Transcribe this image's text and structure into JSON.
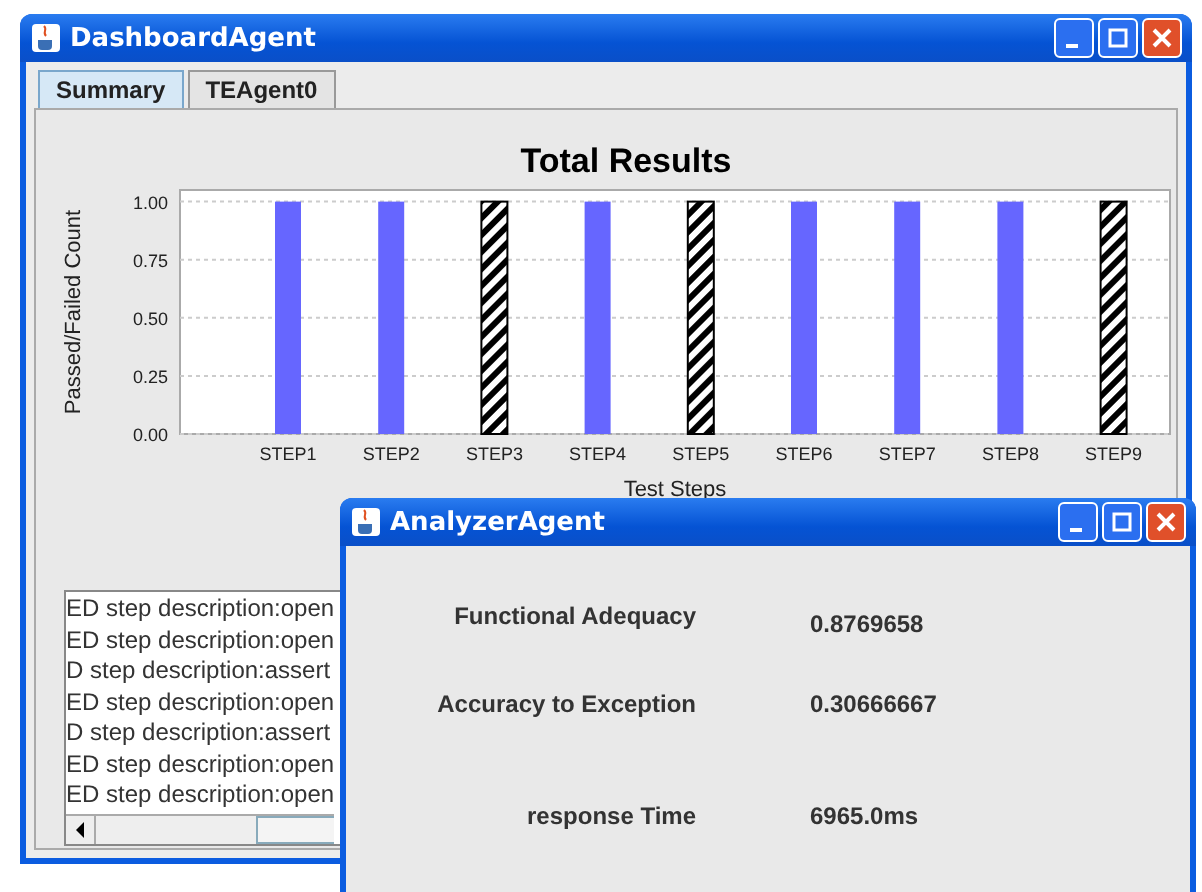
{
  "main_window": {
    "title": "DashboardAgent"
  },
  "tabs": [
    {
      "label": "Summary",
      "selected": true
    },
    {
      "label": "TEAgent0",
      "selected": false
    }
  ],
  "chart": {
    "chart_data": {
      "type": "bar",
      "title": "Total Results",
      "xlabel": "Test Steps",
      "ylabel": "Passed/Failed Count",
      "categories": [
        "STEP1",
        "STEP2",
        "STEP3",
        "STEP4",
        "STEP5",
        "STEP6",
        "STEP7",
        "STEP8",
        "STEP9"
      ],
      "series": [
        {
          "color": "#6666ff",
          "values": [
            1,
            1,
            0,
            1,
            0,
            1,
            1,
            1,
            0
          ]
        },
        {
          "color": "#000000",
          "values": [
            0,
            0,
            1,
            0,
            1,
            0,
            0,
            0,
            1
          ]
        }
      ],
      "grid": true,
      "ylim": [
        0,
        1.05
      ],
      "yticks": [
        {
          "value": 0,
          "label": "0.00"
        },
        {
          "value": 0.25,
          "label": "0.25"
        },
        {
          "value": 0.5,
          "label": "0.50"
        },
        {
          "value": 0.75,
          "label": "0.75"
        },
        {
          "value": 1,
          "label": "1.00"
        }
      ]
    }
  },
  "log_lines": [
    "ED step description:open",
    "ED step description:open",
    "D step description:assert",
    "ED step description:open",
    "D step description:assert",
    "ED step description:open",
    "ED step description:open"
  ],
  "analyzer_window": {
    "title": "AnalyzerAgent",
    "metrics": [
      {
        "label": "Functional Adequacy",
        "value": "0.8769658"
      },
      {
        "label": "Accuracy to Exception",
        "value": "0.30666667"
      },
      {
        "label": "response Time",
        "value": "6965.0ms"
      }
    ]
  }
}
